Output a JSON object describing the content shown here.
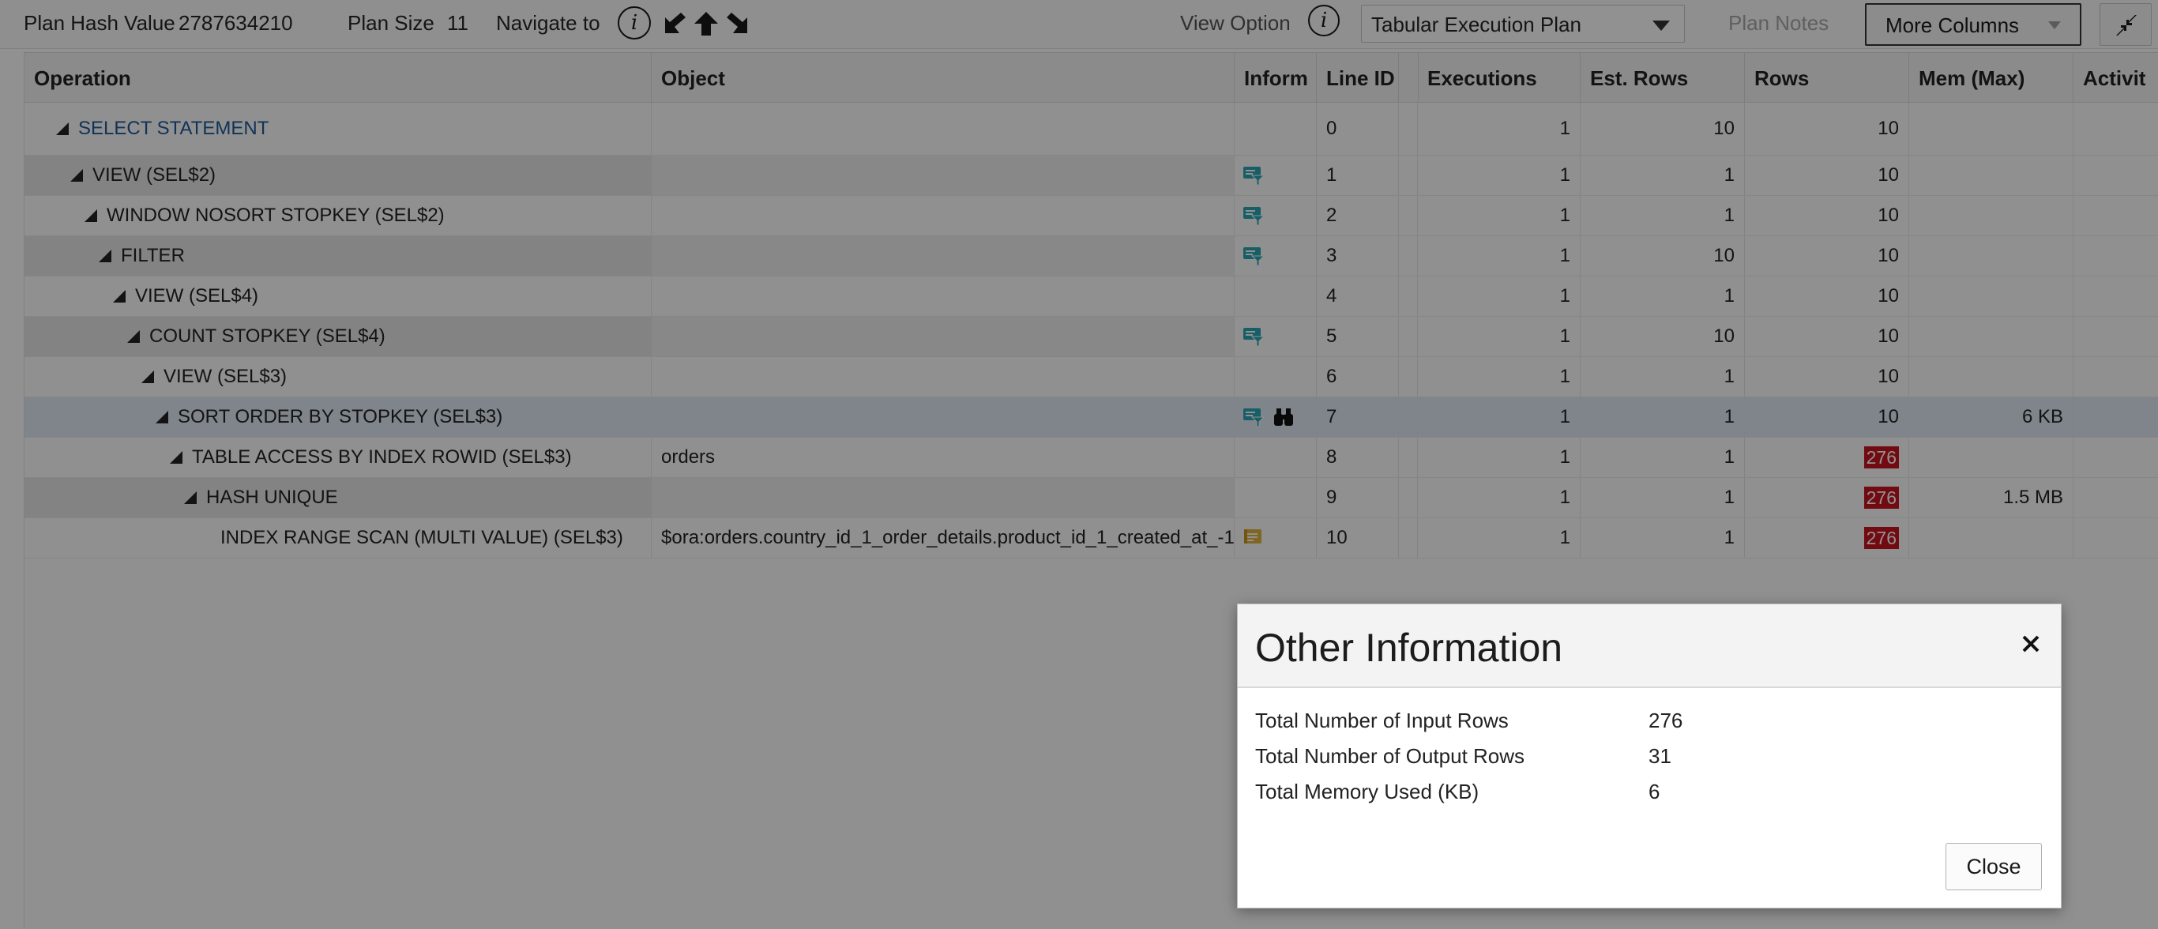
{
  "toolbar": {
    "plan_hash_label": "Plan Hash Value",
    "plan_hash_value": "2787634210",
    "plan_size_label": "Plan Size",
    "plan_size_value": "11",
    "navigate_label": "Navigate to",
    "view_option_label": "View Option",
    "view_option_value": "Tabular Execution Plan",
    "plan_notes_label": "Plan Notes",
    "more_columns_label": "More Columns",
    "info_glyph": "i"
  },
  "table": {
    "columns": [
      "Operation",
      "Object",
      "Inform",
      "Line ID",
      "",
      "Executions",
      "Est. Rows",
      "Rows",
      "Mem (Max)",
      "Activit"
    ],
    "rows": [
      {
        "operation": "SELECT STATEMENT",
        "object": "",
        "line_id": "0",
        "executions": "1",
        "est_rows": "10",
        "rows": "10",
        "mem": "",
        "icons": [],
        "link": true
      },
      {
        "operation": "VIEW (SEL$2)",
        "object": "",
        "line_id": "1",
        "executions": "1",
        "est_rows": "1",
        "rows": "10",
        "mem": "",
        "icons": [
          "filter-predicate-icon"
        ],
        "link": false
      },
      {
        "operation": "WINDOW NOSORT STOPKEY (SEL$2)",
        "object": "",
        "line_id": "2",
        "executions": "1",
        "est_rows": "1",
        "rows": "10",
        "mem": "",
        "icons": [
          "filter-predicate-icon"
        ],
        "link": false
      },
      {
        "operation": "FILTER",
        "object": "",
        "line_id": "3",
        "executions": "1",
        "est_rows": "10",
        "rows": "10",
        "mem": "",
        "icons": [
          "filter-predicate-icon"
        ],
        "link": false
      },
      {
        "operation": "VIEW (SEL$4)",
        "object": "",
        "line_id": "4",
        "executions": "1",
        "est_rows": "1",
        "rows": "10",
        "mem": "",
        "icons": [],
        "link": false
      },
      {
        "operation": "COUNT STOPKEY (SEL$4)",
        "object": "",
        "line_id": "5",
        "executions": "1",
        "est_rows": "10",
        "rows": "10",
        "mem": "",
        "icons": [
          "filter-predicate-icon"
        ],
        "link": false
      },
      {
        "operation": "VIEW (SEL$3)",
        "object": "",
        "line_id": "6",
        "executions": "1",
        "est_rows": "1",
        "rows": "10",
        "mem": "",
        "icons": [],
        "link": false
      },
      {
        "operation": "SORT ORDER BY STOPKEY (SEL$3)",
        "object": "",
        "line_id": "7",
        "executions": "1",
        "est_rows": "1",
        "rows": "10",
        "mem": "6 KB",
        "icons": [
          "filter-predicate-icon",
          "binoculars-icon"
        ],
        "link": false
      },
      {
        "operation": "TABLE ACCESS BY INDEX ROWID (SEL$3)",
        "object": "orders",
        "line_id": "8",
        "executions": "1",
        "est_rows": "1",
        "rows": "276",
        "mem": "",
        "icons": [],
        "link": false,
        "rows_flag": true
      },
      {
        "operation": "HASH UNIQUE",
        "object": "",
        "line_id": "9",
        "executions": "1",
        "est_rows": "1",
        "rows": "276",
        "mem": "1.5 MB",
        "icons": [],
        "link": false,
        "rows_flag": true
      },
      {
        "operation": "INDEX RANGE SCAN (MULTI VALUE) (SEL$3)",
        "object": "$ora:orders.country_id_1_order_details.product_id_1_created_at_-1",
        "line_id": "10",
        "executions": "1",
        "est_rows": "1",
        "rows": "276",
        "mem": "",
        "icons": [
          "access-predicate-icon"
        ],
        "link": false,
        "rows_flag": true
      }
    ]
  },
  "dialog": {
    "title": "Other Information",
    "items": [
      {
        "label": "Total Number of Input Rows",
        "value": "276"
      },
      {
        "label": "Total Number of Output Rows",
        "value": "31"
      },
      {
        "label": "Total Memory Used (KB)",
        "value": "6"
      }
    ],
    "close_label": "Close"
  },
  "colors": {
    "flag_red": "#c8141e",
    "link_blue": "#1e5a9a",
    "predicate_teal": "#2aa6b4",
    "access_gold": "#e0b43c"
  }
}
